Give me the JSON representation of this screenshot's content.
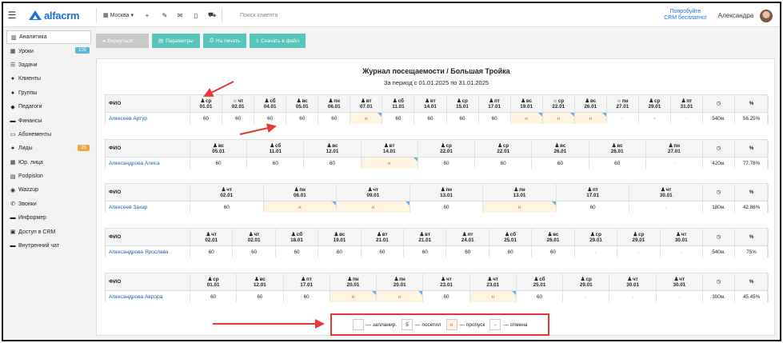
{
  "header": {
    "menu_icon": "hamburger-icon",
    "logo_text": "alfacrm",
    "city": "Москва",
    "search_placeholder": "Поиск клиента",
    "promo_line1": "Попробуйте",
    "promo_line2": "CRM бесплатно!",
    "user_name": "Александра"
  },
  "sidebar": {
    "items": [
      {
        "label": "Аналитика",
        "icon": "chart-icon"
      },
      {
        "label": "Уроки",
        "icon": "calendar-icon",
        "badge": "105",
        "badge_color": "#5ab4d6"
      },
      {
        "label": "Задачи",
        "icon": "tasks-icon"
      },
      {
        "label": "Клиенты",
        "icon": "user-icon"
      },
      {
        "label": "Группы",
        "icon": "users-icon"
      },
      {
        "label": "Педагоги",
        "icon": "teacher-icon"
      },
      {
        "label": "Финансы",
        "icon": "money-icon"
      },
      {
        "label": "Абонементы",
        "icon": "ticket-icon"
      },
      {
        "label": "Лиды",
        "icon": "lead-icon",
        "badge": "25",
        "badge_color": "#f0a640"
      },
      {
        "label": "Юр. лица",
        "icon": "building-icon"
      },
      {
        "label": "Podpislon",
        "icon": "doc-icon"
      },
      {
        "label": "Wazzup",
        "icon": "chat-icon"
      },
      {
        "label": "Звонки",
        "icon": "phone-icon"
      },
      {
        "label": "Информер",
        "icon": "informer-icon"
      },
      {
        "label": "Доступ в CRM",
        "icon": "lock-icon"
      },
      {
        "label": "Внутренний чат",
        "icon": "message-icon"
      }
    ]
  },
  "toolbar": {
    "back_label": "Вернуться",
    "params_label": "Параметры",
    "print_label": "На печать",
    "download_label": "Скачать в файл"
  },
  "report": {
    "title": "Журнал посещаемости / Большая Тройка",
    "period": "За период с 01.01.2025 по 31.01.2025",
    "fio_label": "ФИО",
    "minutes_icon": "◷",
    "percent_label": "%",
    "blocks": [
      {
        "name": "Алексеев Артур",
        "minutes": "540м.",
        "percent": "56.25%",
        "lessons": [
          {
            "icon": "person",
            "day": "ср",
            "date": "01.01",
            "value": "60",
            "state": "visit"
          },
          {
            "icon": "sun",
            "day": "чт",
            "date": "02.01",
            "value": "60",
            "state": "visit"
          },
          {
            "icon": "person",
            "day": "сб",
            "date": "04.01",
            "value": "60",
            "state": "visit"
          },
          {
            "icon": "person",
            "day": "вс",
            "date": "05.01",
            "value": "60",
            "state": "visit"
          },
          {
            "icon": "person",
            "day": "пн",
            "date": "06.01",
            "value": "60",
            "state": "visit"
          },
          {
            "icon": "person",
            "day": "вт",
            "date": "07.01",
            "value": "н",
            "state": "miss"
          },
          {
            "icon": "person",
            "day": "сб",
            "date": "11.01",
            "value": "60",
            "state": "visit"
          },
          {
            "icon": "person",
            "day": "вт",
            "date": "14.01",
            "value": "60",
            "state": "visit"
          },
          {
            "icon": "person",
            "day": "ср",
            "date": "15.01",
            "value": "60",
            "state": "visit"
          },
          {
            "icon": "person",
            "day": "пт",
            "date": "17.01",
            "value": "60",
            "state": "visit"
          },
          {
            "icon": "person",
            "day": "вс",
            "date": "19.01",
            "value": "н",
            "state": "miss"
          },
          {
            "icon": "sun",
            "day": "ср",
            "date": "22.01",
            "value": "н",
            "state": "miss"
          },
          {
            "icon": "person",
            "day": "вс",
            "date": "26.01",
            "value": "н",
            "state": "miss"
          },
          {
            "icon": "sun",
            "day": "пн",
            "date": "27.01",
            "value": "-",
            "state": "empty"
          },
          {
            "icon": "person",
            "day": "ср",
            "date": "29.01",
            "value": "-",
            "state": "cancel"
          },
          {
            "icon": "person",
            "day": "пт",
            "date": "31.01",
            "value": "-",
            "state": "empty"
          }
        ]
      },
      {
        "name": "Александрова Алиса",
        "minutes": "420м.",
        "percent": "77.78%",
        "lessons": [
          {
            "icon": "person",
            "day": "вс",
            "date": "05.01",
            "value": "60",
            "state": "visit"
          },
          {
            "icon": "person",
            "day": "сб",
            "date": "11.01",
            "value": "60",
            "state": "visit"
          },
          {
            "icon": "person",
            "day": "вс",
            "date": "12.01",
            "value": "60",
            "state": "visit"
          },
          {
            "icon": "person",
            "day": "вт",
            "date": "14.01",
            "value": "н",
            "state": "miss"
          },
          {
            "icon": "person",
            "day": "ср",
            "date": "22.01",
            "value": "60",
            "state": "visit"
          },
          {
            "icon": "person",
            "day": "ср",
            "date": "22.01",
            "value": "60",
            "state": "visit"
          },
          {
            "icon": "person",
            "day": "вс",
            "date": "26.01",
            "value": "60",
            "state": "visit"
          },
          {
            "icon": "person",
            "day": "вс",
            "date": "26.01",
            "value": "60",
            "state": "visit"
          },
          {
            "icon": "person",
            "day": "пн",
            "date": "27.01",
            "value": "-",
            "state": "empty"
          }
        ]
      },
      {
        "name": "Алексеев Захар",
        "minutes": "180м.",
        "percent": "42.86%",
        "lessons": [
          {
            "icon": "person",
            "day": "чт",
            "date": "02.01",
            "value": "60",
            "state": "visit"
          },
          {
            "icon": "person",
            "day": "пн",
            "date": "06.01",
            "value": "н",
            "state": "miss"
          },
          {
            "icon": "person",
            "day": "чт",
            "date": "09.01",
            "value": "н",
            "state": "miss"
          },
          {
            "icon": "person",
            "day": "пн",
            "date": "13.01",
            "value": "60",
            "state": "visit"
          },
          {
            "icon": "person",
            "day": "пн",
            "date": "13.01",
            "value": "н",
            "state": "miss"
          },
          {
            "icon": "person",
            "day": "пт",
            "date": "17.01",
            "value": "60",
            "state": "visit"
          },
          {
            "icon": "person",
            "day": "чт",
            "date": "30.01",
            "value": "-",
            "state": "empty"
          }
        ]
      },
      {
        "name": "Александрова Ярослава",
        "minutes": "540м.",
        "percent": "75%",
        "lessons": [
          {
            "icon": "person",
            "day": "чт",
            "date": "02.01",
            "value": "60",
            "state": "visit"
          },
          {
            "icon": "person",
            "day": "чт",
            "date": "02.01",
            "value": "60",
            "state": "visit"
          },
          {
            "icon": "person",
            "day": "сб",
            "date": "18.01",
            "value": "60",
            "state": "visit"
          },
          {
            "icon": "person",
            "day": "вс",
            "date": "19.01",
            "value": "60",
            "state": "visit"
          },
          {
            "icon": "person",
            "day": "вт",
            "date": "21.01",
            "value": "60",
            "state": "visit"
          },
          {
            "icon": "person",
            "day": "вт",
            "date": "21.01",
            "value": "60",
            "state": "visit"
          },
          {
            "icon": "person",
            "day": "пт",
            "date": "24.01",
            "value": "60",
            "state": "visit"
          },
          {
            "icon": "person",
            "day": "сб",
            "date": "25.01",
            "value": "60",
            "state": "visit"
          },
          {
            "icon": "person",
            "day": "вс",
            "date": "26.01",
            "value": "60",
            "state": "visit"
          },
          {
            "icon": "person",
            "day": "ср",
            "date": "29.01",
            "value": "-",
            "state": "empty"
          },
          {
            "icon": "person",
            "day": "ср",
            "date": "29.01",
            "value": "-",
            "state": "empty"
          },
          {
            "icon": "person",
            "day": "чт",
            "date": "30.01",
            "value": "-",
            "state": "empty"
          }
        ]
      },
      {
        "name": "Александрова Аврора",
        "minutes": "300м.",
        "percent": "45.45%",
        "lessons": [
          {
            "icon": "person",
            "day": "ср",
            "date": "01.01",
            "value": "60",
            "state": "visit"
          },
          {
            "icon": "person",
            "day": "вс",
            "date": "12.01",
            "value": "60",
            "state": "visit"
          },
          {
            "icon": "person",
            "day": "пт",
            "date": "17.01",
            "value": "60",
            "state": "visit"
          },
          {
            "icon": "person",
            "day": "пн",
            "date": "20.01",
            "value": "н",
            "state": "miss"
          },
          {
            "icon": "person",
            "day": "пн",
            "date": "20.01",
            "value": "н",
            "state": "miss"
          },
          {
            "icon": "person",
            "day": "чт",
            "date": "23.01",
            "value": "60",
            "state": "visit"
          },
          {
            "icon": "person",
            "day": "чт",
            "date": "23.01",
            "value": "н",
            "state": "miss"
          },
          {
            "icon": "person",
            "day": "сб",
            "date": "25.01",
            "value": "60",
            "state": "visit"
          },
          {
            "icon": "person",
            "day": "ср",
            "date": "29.01",
            "value": "-",
            "state": "empty"
          },
          {
            "icon": "person",
            "day": "чт",
            "date": "30.01",
            "value": "-",
            "state": "empty"
          },
          {
            "icon": "person",
            "day": "чт",
            "date": "30.01",
            "value": "-",
            "state": "empty"
          }
        ]
      }
    ]
  },
  "legend": {
    "planned_label": "— запланир.",
    "visit_sample": "5",
    "visit_label": "— посетил",
    "miss_sample": "н",
    "miss_label": "— пропуск",
    "cancel_sample": "-",
    "cancel_label": "— отмена"
  },
  "colors": {
    "accent": "#1a73e8",
    "teal_button": "#57c5bb",
    "miss_bg": "#fdf4e1",
    "annotation_red": "#e53935"
  }
}
